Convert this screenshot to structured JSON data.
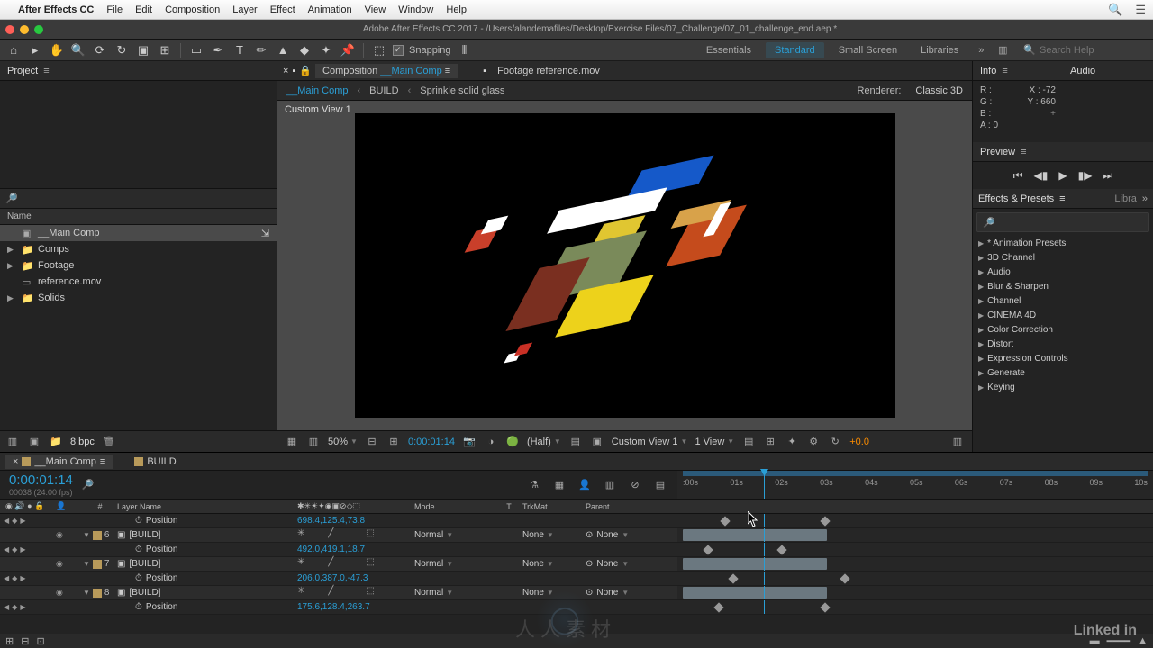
{
  "mac_menu": {
    "app": "After Effects CC",
    "items": [
      "File",
      "Edit",
      "Composition",
      "Layer",
      "Effect",
      "Animation",
      "View",
      "Window",
      "Help"
    ]
  },
  "window_title": "Adobe After Effects CC 2017 - /Users/alandemafiles/Desktop/Exercise Files/07_Challenge/07_01_challenge_end.aep *",
  "tool_row": {
    "snapping_label": "Snapping",
    "workspaces": [
      "Essentials",
      "Standard",
      "Small Screen",
      "Libraries"
    ],
    "active_ws": "Standard",
    "search_placeholder": "Search Help"
  },
  "project_panel": {
    "title": "Project",
    "col_name": "Name",
    "items": [
      {
        "type": "comp",
        "label": "__Main Comp",
        "sel": true
      },
      {
        "type": "folder",
        "label": "Comps"
      },
      {
        "type": "folder",
        "label": "Footage"
      },
      {
        "type": "file",
        "label": "reference.mov"
      },
      {
        "type": "folder",
        "label": "Solids"
      }
    ],
    "bpc": "8 bpc"
  },
  "comp_panel": {
    "tab_prefix": "Composition",
    "tab_comp": "__Main Comp",
    "other_tab": "Footage reference.mov",
    "crumbs": [
      "__Main Comp",
      "BUILD",
      "Sprinkle solid glass"
    ],
    "renderer_label": "Renderer:",
    "renderer_value": "Classic 3D",
    "view_label": "Custom View 1",
    "zoom": "50%",
    "timecode": "0:00:01:14",
    "res": "(Half)",
    "view_dd": "Custom View 1",
    "views": "1 View",
    "exposure": "+0.0"
  },
  "info_panel": {
    "title": "Info",
    "r": "R :",
    "g": "G :",
    "b": "B :",
    "a": "A : 0",
    "x": "X : -72",
    "y": "Y : 660"
  },
  "audio_panel": {
    "title": "Audio"
  },
  "preview_panel": {
    "title": "Preview"
  },
  "ep_panel": {
    "title": "Effects & Presets",
    "other": "Libra",
    "cats": [
      "* Animation Presets",
      "3D Channel",
      "Audio",
      "Blur & Sharpen",
      "Channel",
      "CINEMA 4D",
      "Color Correction",
      "Distort",
      "Expression Controls",
      "Generate",
      "Keying"
    ]
  },
  "timeline": {
    "tabs": [
      "__Main Comp",
      "BUILD"
    ],
    "active_tab": 0,
    "tc": "0:00:01:14",
    "tc_sub": "00038 (24.00 fps)",
    "columns": {
      "num": "#",
      "layerName": "Layer Name",
      "mode": "Mode",
      "t": "T",
      "trkmat": "TrkMat",
      "parent": "Parent"
    },
    "ruler": [
      ":00s",
      "01s",
      "02s",
      "03s",
      "04s",
      "05s",
      "06s",
      "07s",
      "08s",
      "09s",
      "10s"
    ],
    "layers": [
      {
        "type": "pos",
        "value": "698.4,125.4,73.8",
        "kf": [
          49,
          160
        ]
      },
      {
        "type": "layer",
        "num": "6",
        "name": "[BUILD]",
        "mode": "Normal",
        "trk": "None",
        "parent": "None"
      },
      {
        "type": "pos",
        "value": "492.0,419.1,18.7",
        "kf": [
          30,
          112
        ]
      },
      {
        "type": "layer",
        "num": "7",
        "name": "[BUILD]",
        "mode": "Normal",
        "trk": "None",
        "parent": "None"
      },
      {
        "type": "pos",
        "value": "206.0,387.0,-47.3",
        "kf": [
          58,
          182
        ]
      },
      {
        "type": "layer",
        "num": "8",
        "name": "[BUILD]",
        "mode": "Normal",
        "trk": "None",
        "parent": "None"
      },
      {
        "type": "pos",
        "value": "175.6,128.4,263.7",
        "kf": [
          42,
          160
        ]
      }
    ],
    "prop_position": "Position"
  },
  "chart_data": null
}
